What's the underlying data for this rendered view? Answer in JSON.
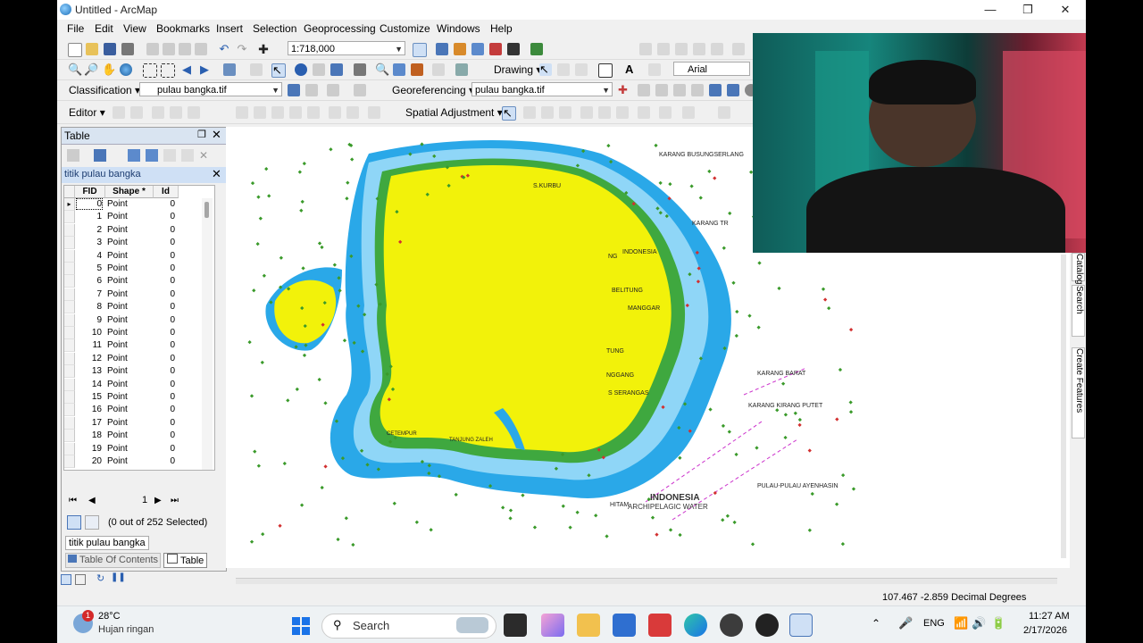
{
  "window": {
    "title": "Untitled - ArcMap"
  },
  "menu": [
    "File",
    "Edit",
    "View",
    "Bookmarks",
    "Insert",
    "Selection",
    "Geoprocessing",
    "Customize",
    "Windows",
    "Help"
  ],
  "toolbar": {
    "scale": "1:718,000",
    "drawing_label": "Drawing",
    "font_name": "Arial",
    "classification_label": "Classification",
    "layer_combo": "pulau bangka.tif",
    "georef_label": "Georeferencing",
    "georef_combo": "pulau bangka.tif",
    "editor_label": "Editor",
    "spatial_adj_label": "Spatial Adjustment"
  },
  "table": {
    "window_title": "Table",
    "layer_title": "titik pulau bangka",
    "columns": [
      "FID",
      "Shape *",
      "Id"
    ],
    "rows": [
      [
        "0",
        "Point",
        "0"
      ],
      [
        "1",
        "Point",
        "0"
      ],
      [
        "2",
        "Point",
        "0"
      ],
      [
        "3",
        "Point",
        "0"
      ],
      [
        "4",
        "Point",
        "0"
      ],
      [
        "5",
        "Point",
        "0"
      ],
      [
        "6",
        "Point",
        "0"
      ],
      [
        "7",
        "Point",
        "0"
      ],
      [
        "8",
        "Point",
        "0"
      ],
      [
        "9",
        "Point",
        "0"
      ],
      [
        "10",
        "Point",
        "0"
      ],
      [
        "11",
        "Point",
        "0"
      ],
      [
        "12",
        "Point",
        "0"
      ],
      [
        "13",
        "Point",
        "0"
      ],
      [
        "14",
        "Point",
        "0"
      ],
      [
        "15",
        "Point",
        "0"
      ],
      [
        "16",
        "Point",
        "0"
      ],
      [
        "17",
        "Point",
        "0"
      ],
      [
        "18",
        "Point",
        "0"
      ],
      [
        "19",
        "Point",
        "0"
      ],
      [
        "20",
        "Point",
        "0"
      ]
    ],
    "page_number": "1",
    "selection_status": "(0 out of 252 Selected)",
    "tab_layer": "titik pulau bangka",
    "bottom_tabs": [
      "Table Of Contents",
      "Table"
    ]
  },
  "map_labels": {
    "karang": "KARANG BUSUNGSERLANG",
    "kurbu": "S.KURBU",
    "karang_tr": "KARANG TR",
    "indonesia1": "INDONESIA",
    "belitung": "BELITUNG",
    "manggar": "MANGGAR",
    "ng": "NG",
    "tung": "TUNG",
    "nggang": "NGGANG",
    "serangas": "S SERANGAS",
    "karang_bara": "KARANG BARAT",
    "karang_kiri": "KARANG KIRANG PUTET",
    "indonesia2": "INDONESIA",
    "archi": "ARCHIPELAGIC WATER",
    "pulau": "PULAU-PULAU AYENHASIN",
    "hitam": "HITAM",
    "tanjung": "TANJUNG ZALEH",
    "cetempur": "CETEMPUR"
  },
  "side_tabs": [
    "Catalog",
    "Search",
    "Create Features"
  ],
  "status": {
    "coords": "107.467  -2.859 Decimal Degrees"
  },
  "taskbar": {
    "weather_temp": "28°C",
    "weather_desc": "Hujan ringan",
    "weather_badge": "1",
    "search_placeholder": "Search",
    "lang": "ENG",
    "time": "11:27 AM",
    "date": "2/17/2026"
  }
}
